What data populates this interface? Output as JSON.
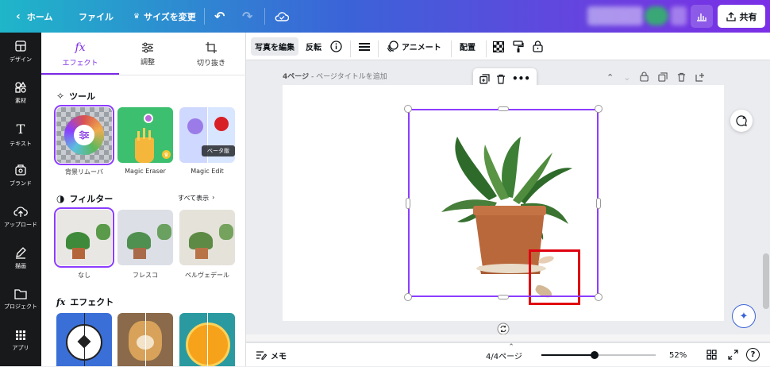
{
  "topbar": {
    "home_label": "ホーム",
    "file_label": "ファイル",
    "resize_label": "サイズを変更",
    "share_label": "共有"
  },
  "rail": {
    "items": [
      {
        "label": "デザイン",
        "icon": "layout-icon"
      },
      {
        "label": "素材",
        "icon": "shapes-icon"
      },
      {
        "label": "テキスト",
        "icon": "text-icon"
      },
      {
        "label": "ブランド",
        "icon": "brand-icon"
      },
      {
        "label": "アップロード",
        "icon": "upload-icon"
      },
      {
        "label": "描画",
        "icon": "draw-icon"
      },
      {
        "label": "プロジェクト",
        "icon": "folder-icon"
      },
      {
        "label": "アプリ",
        "icon": "apps-icon"
      }
    ]
  },
  "panel": {
    "tabs": [
      {
        "label": "エフェクト",
        "icon": "fx-icon"
      },
      {
        "label": "調整",
        "icon": "sliders-icon"
      },
      {
        "label": "切り抜き",
        "icon": "crop-icon"
      }
    ],
    "tools_title": "ツール",
    "tools": [
      {
        "label": "背景リムーバ"
      },
      {
        "label": "Magic Eraser"
      },
      {
        "label": "Magic Edit",
        "badge": "ベータ版"
      }
    ],
    "filters_title": "フィルター",
    "see_all": "すべて表示",
    "filters": [
      {
        "label": "なし"
      },
      {
        "label": "フレスコ"
      },
      {
        "label": "ベルヴェデール"
      }
    ],
    "effects_title": "エフェクト"
  },
  "context_toolbar": {
    "edit_photo": "写真を編集",
    "flip": "反転",
    "animate": "アニメート",
    "position": "配置"
  },
  "page": {
    "page_label": "4ページ",
    "title_placeholder": "ページタイトルを追加"
  },
  "bottombar": {
    "notes_label": "メモ",
    "page_count": "4/4ページ",
    "zoom": "52%",
    "zoom_fraction": 0.52,
    "help": "?"
  },
  "colors": {
    "accent": "#7d2ae8",
    "highlight": "#e0000f",
    "rail_bg": "#18191b"
  }
}
